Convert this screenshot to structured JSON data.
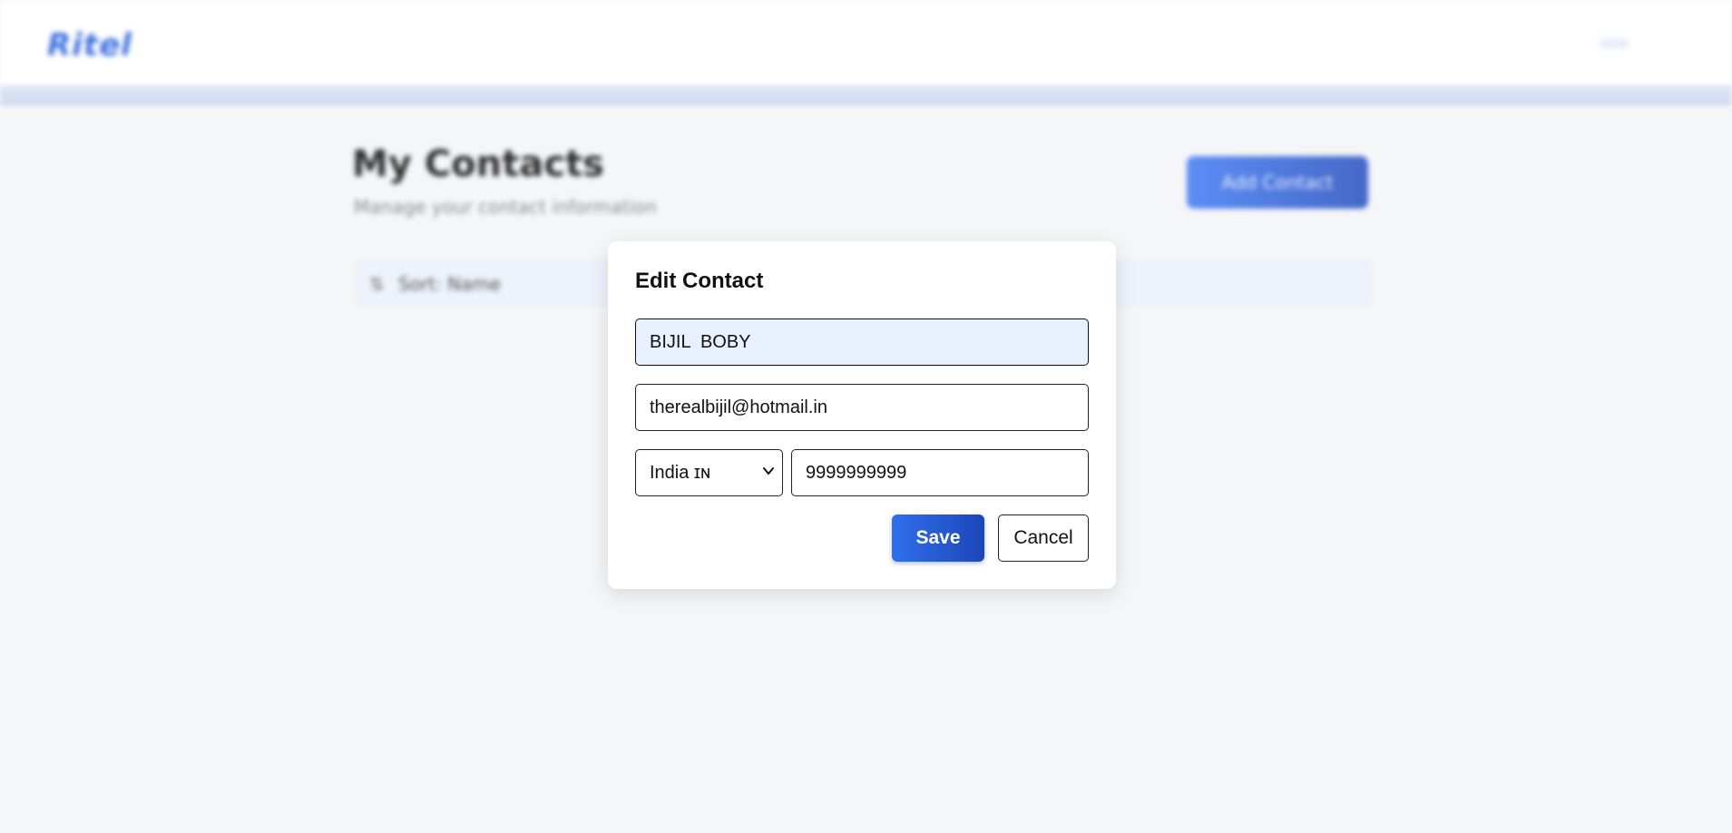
{
  "app": {
    "logo_text": "Ritel"
  },
  "background": {
    "page_title": "My Contacts",
    "page_subtitle": "Manage your contact information",
    "add_contact_label": "Add Contact",
    "search_text": "Sort: Name"
  },
  "modal": {
    "title": "Edit Contact",
    "name_value": "BIJIL  BOBY",
    "email_value": "therealbijil@hotmail.in",
    "country_selected": "India ɪɴ",
    "phone_value": "9999999999",
    "save_label": "Save",
    "cancel_label": "Cancel"
  },
  "colors": {
    "accent": "#2f6fec",
    "accent_dark": "#1c46b8",
    "name_field_bg": "#e8effd",
    "backdrop": "#f5f6f8"
  },
  "icons": {
    "select_chevron": "chevron-down-icon",
    "search": "search-icon"
  }
}
